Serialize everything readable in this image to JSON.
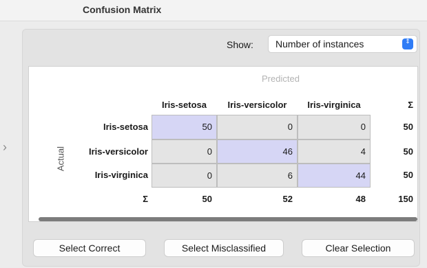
{
  "window": {
    "title": "Confusion Matrix"
  },
  "sidebar_toggle": {
    "glyph": "›"
  },
  "controls": {
    "show_label": "Show:",
    "show_value": "Number of instances",
    "chevron": "⇕"
  },
  "matrix": {
    "predicted_label": "Predicted",
    "actual_label": "Actual",
    "sum_symbol": "Σ",
    "columns": [
      "Iris-setosa",
      "Iris-versicolor",
      "Iris-virginica"
    ],
    "rows": [
      "Iris-setosa",
      "Iris-versicolor",
      "Iris-virginica"
    ],
    "values": [
      [
        "50",
        "0",
        "0"
      ],
      [
        "0",
        "46",
        "4"
      ],
      [
        "0",
        "6",
        "44"
      ]
    ],
    "row_sums": [
      "50",
      "50",
      "50"
    ],
    "col_sums": [
      "50",
      "52",
      "48"
    ],
    "total": "150"
  },
  "buttons": {
    "select_correct": "Select Correct",
    "select_misclassified": "Select Misclassified",
    "clear_selection": "Clear Selection"
  },
  "colors": {
    "diagonal": "#d6d6f5",
    "off_diagonal": "#e4e4e4",
    "accent": "#2f7cf6"
  }
}
